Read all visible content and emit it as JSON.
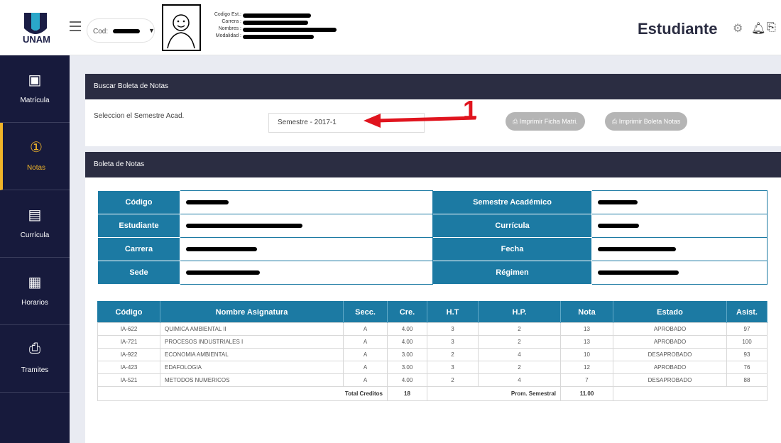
{
  "brand": {
    "logo_text": "UNAM"
  },
  "header": {
    "cod_label": "Cod:",
    "info_labels": [
      "Codigo Est.:",
      "Carrera :",
      "Nombres :",
      "Modalidad :"
    ],
    "role": "Estudiante"
  },
  "sidebar": {
    "items": [
      {
        "label": "Matrícula",
        "icon": "calendar-icon"
      },
      {
        "label": "Notas",
        "icon": "medal-icon"
      },
      {
        "label": "Currícula",
        "icon": "clipboard-icon"
      },
      {
        "label": "Horarios",
        "icon": "schedule-icon"
      },
      {
        "label": "Tramites",
        "icon": "tray-icon"
      }
    ]
  },
  "buscar": {
    "title": "Buscar Boleta de Notas",
    "select_label": "Seleccion el Semestre Acad.",
    "select_value": "Semestre - 2017-1",
    "btn_ficha": "Imprimir Ficha Matri.",
    "btn_boleta": "Imprimir Boleta Notas",
    "annotation": "1"
  },
  "boleta": {
    "title": "Boleta de Notas",
    "labels": {
      "codigo": "Código",
      "estudiante": "Estudiante",
      "carrera": "Carrera",
      "sede": "Sede",
      "semestre": "Semestre Académico",
      "curricula": "Currícula",
      "fecha": "Fecha",
      "regimen": "Régimen"
    }
  },
  "grades": {
    "headers": [
      "Código",
      "Nombre Asignatura",
      "Secc.",
      "Cre.",
      "H.T",
      "H.P.",
      "Nota",
      "Estado",
      "Asist."
    ],
    "rows": [
      [
        "IA-622",
        "QUIMICA AMBIENTAL II",
        "A",
        "4.00",
        "3",
        "2",
        "13",
        "APROBADO",
        "97"
      ],
      [
        "IA-721",
        "PROCESOS INDUSTRIALES I",
        "A",
        "4.00",
        "3",
        "2",
        "13",
        "APROBADO",
        "100"
      ],
      [
        "IA-922",
        "ECONOMIA AMBIENTAL",
        "A",
        "3.00",
        "2",
        "4",
        "10",
        "DESAPROBADO",
        "93"
      ],
      [
        "IA-423",
        "EDAFOLOGIA",
        "A",
        "3.00",
        "3",
        "2",
        "12",
        "APROBADO",
        "76"
      ],
      [
        "IA-521",
        "METODOS NUMERICOS",
        "A",
        "4.00",
        "2",
        "4",
        "7",
        "DESAPROBADO",
        "88"
      ]
    ],
    "total_label": "Total Creditos",
    "total_value": "18",
    "prom_label": "Prom. Semestral",
    "prom_value": "11.00"
  }
}
